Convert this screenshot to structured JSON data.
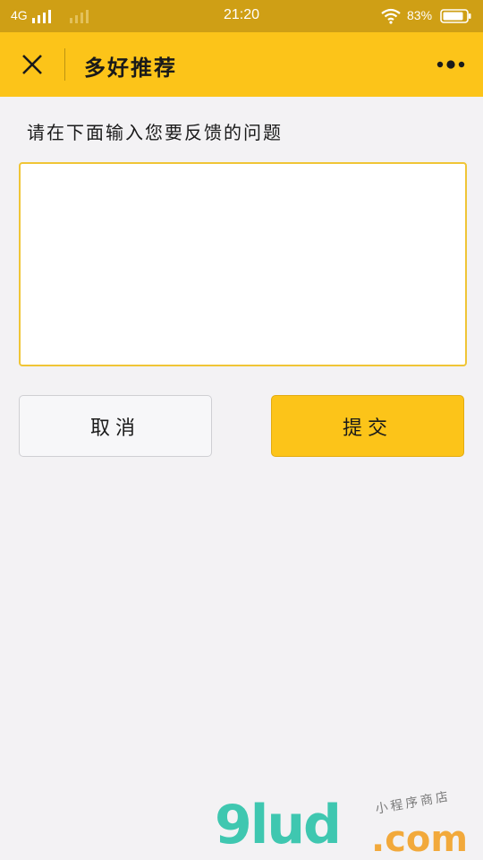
{
  "status_bar": {
    "network": "4G",
    "time": "21:20",
    "battery": "83%",
    "icons": [
      "signal-icon",
      "signal-weak-icon",
      "wifi-icon",
      "battery-icon"
    ]
  },
  "nav": {
    "title": "多好推荐",
    "close_icon": "close-icon",
    "more_icon": "more-dots-icon"
  },
  "form": {
    "prompt": "请在下面输入您要反馈的问题",
    "input_value": "",
    "input_placeholder": ""
  },
  "buttons": {
    "cancel_label": "取消",
    "submit_label": "提交"
  },
  "watermark": {
    "brand": "9lud",
    "domain": ".com",
    "tagline": "小程序商店"
  },
  "colors": {
    "status_bar": "#cf9f15",
    "accent": "#fcc419",
    "background": "#f3f2f4",
    "input_border": "#f0c536"
  }
}
